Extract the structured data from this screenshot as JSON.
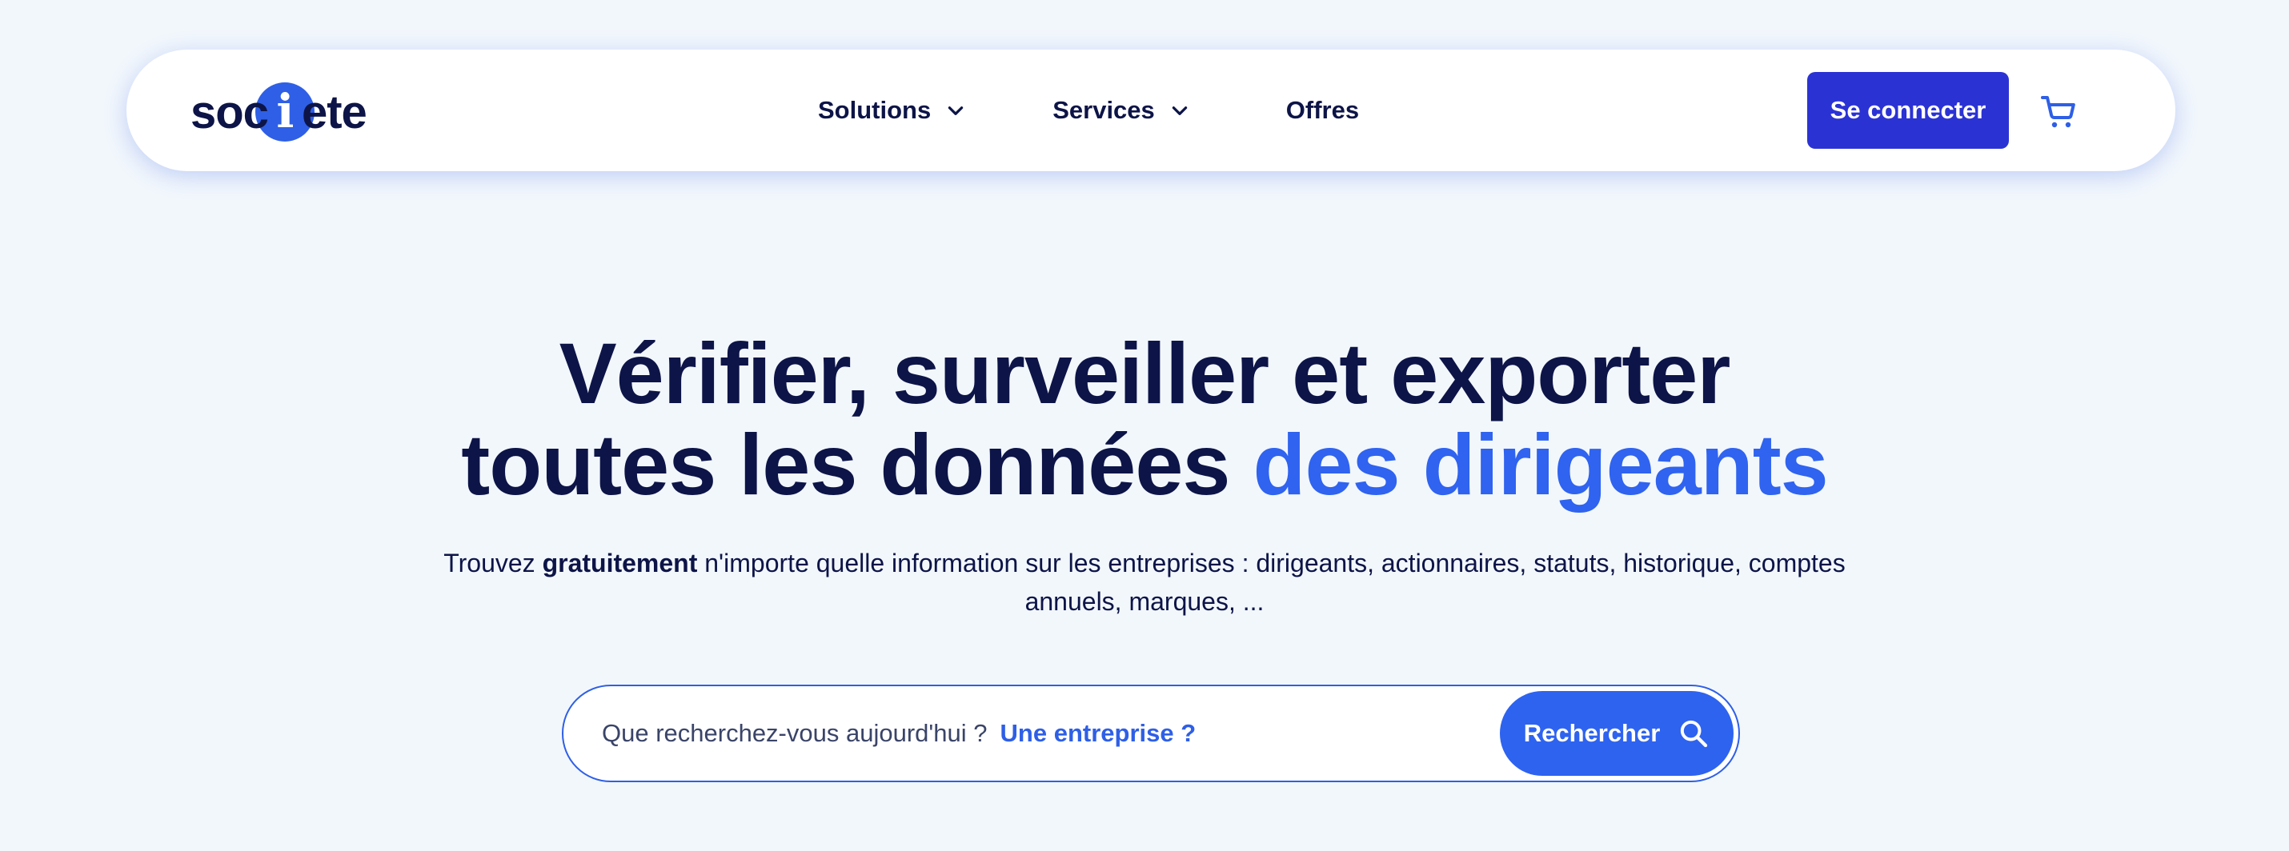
{
  "header": {
    "logo": {
      "before": "soc",
      "letter": "i",
      "after": "ete"
    },
    "nav": [
      {
        "label": "Solutions",
        "has_dropdown": true,
        "icon": "chevron-down-icon"
      },
      {
        "label": "Services",
        "has_dropdown": true,
        "icon": "chevron-down-icon"
      },
      {
        "label": "Offres",
        "has_dropdown": false
      }
    ],
    "connect_label": "Se connecter",
    "cart_icon": "cart-icon"
  },
  "hero": {
    "title_line1": "Vérifier, surveiller et exporter",
    "title_line2_plain": "toutes les données ",
    "title_line2_accent": "des dirigeants",
    "subtitle_pre": "Trouvez ",
    "subtitle_bold": "gratuitement",
    "subtitle_post": " n'importe quelle information sur les entreprises : dirigeants, actionnaires, statuts, historique, comptes annuels, marques, ..."
  },
  "search": {
    "placeholder": "Que recherchez-vous aujourd'hui ?",
    "hint": "Une entreprise ?",
    "button_label": "Rechercher",
    "icon": "search-icon"
  },
  "colors": {
    "background": "#f2f7fc",
    "navy": "#0d1447",
    "accent": "#2f63f0",
    "connect_button": "#2b32d4"
  }
}
